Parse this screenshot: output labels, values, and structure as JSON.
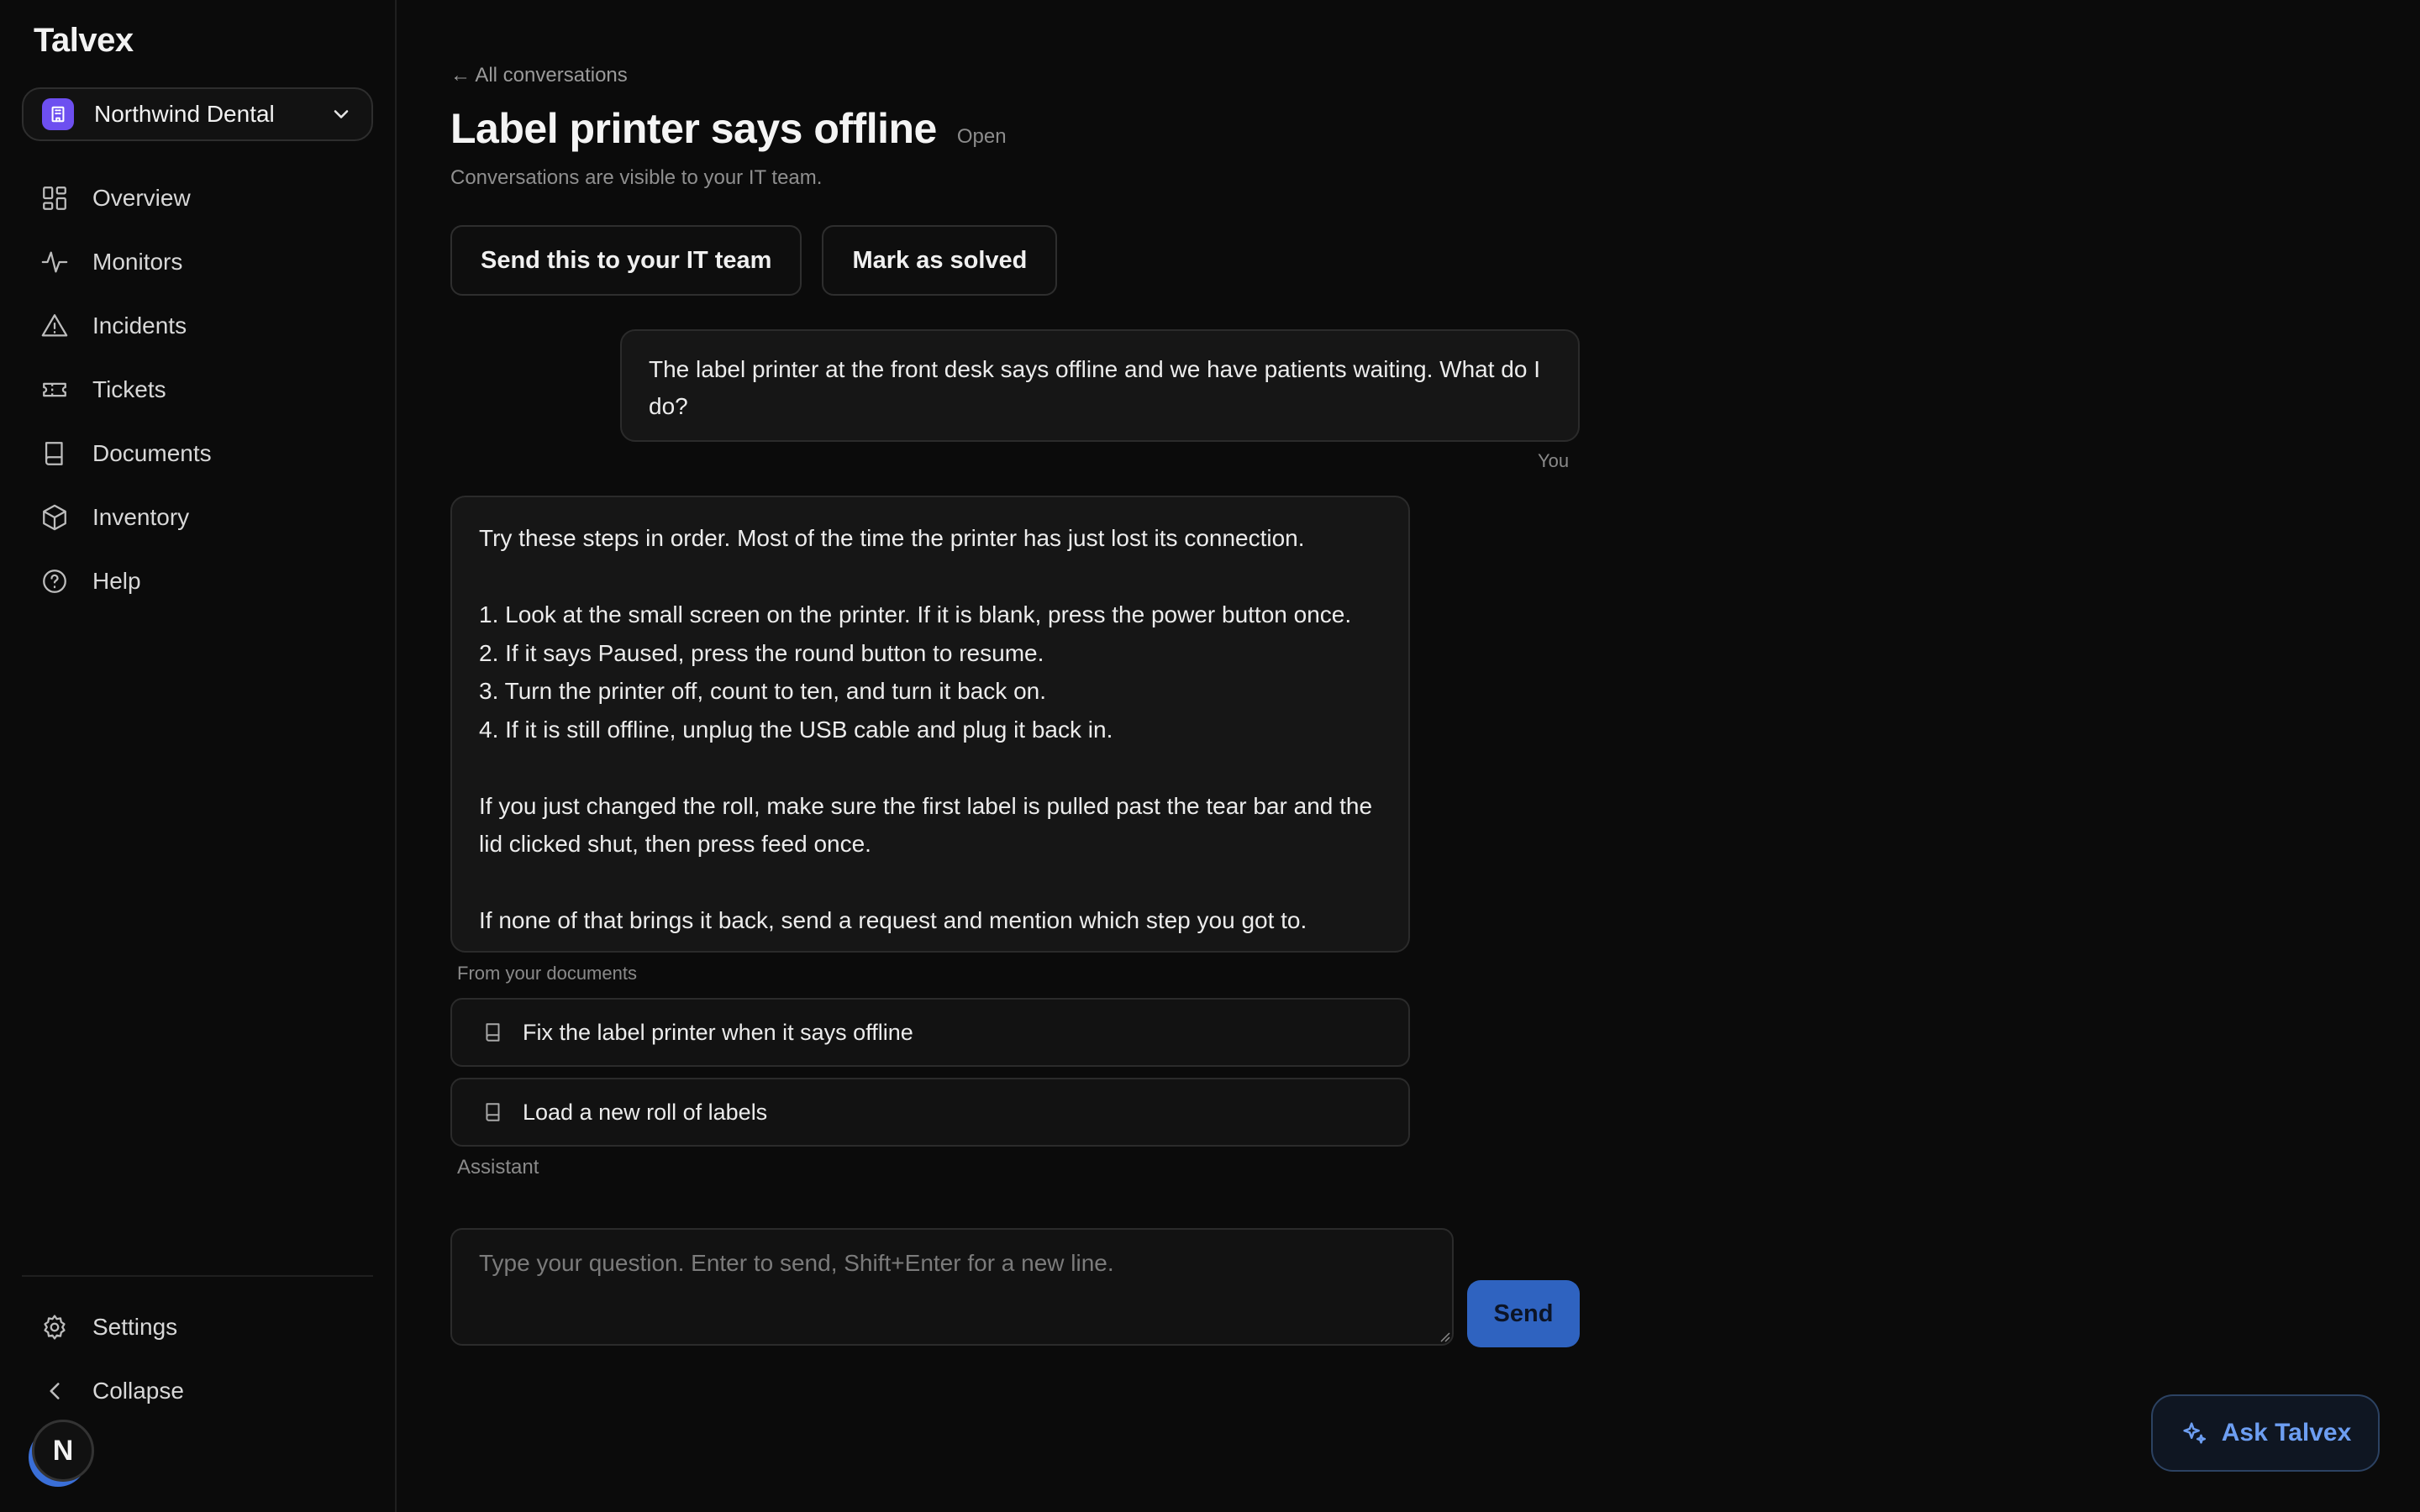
{
  "app": {
    "name": "Talvex"
  },
  "org": {
    "name": "Northwind Dental"
  },
  "sidebar": {
    "items": [
      {
        "label": "Overview",
        "icon": "grid-icon"
      },
      {
        "label": "Monitors",
        "icon": "pulse-icon"
      },
      {
        "label": "Incidents",
        "icon": "warning-icon"
      },
      {
        "label": "Tickets",
        "icon": "ticket-icon"
      },
      {
        "label": "Documents",
        "icon": "book-icon"
      },
      {
        "label": "Inventory",
        "icon": "box-icon"
      },
      {
        "label": "Help",
        "icon": "help-icon"
      }
    ],
    "bottom": [
      {
        "label": "Settings",
        "icon": "gear-icon"
      },
      {
        "label": "Collapse",
        "icon": "chevron-left-icon"
      }
    ],
    "avatar_initial": "N"
  },
  "header": {
    "back_link": "← All conversations",
    "title": "Label printer says offline",
    "status": "Open",
    "subtitle": "Conversations are visible to your IT team."
  },
  "actions": {
    "send_it": "Send this to your IT team",
    "mark_solved": "Mark as solved"
  },
  "conversation": {
    "user_message": "The label printer at the front desk says offline and we have patients waiting. What do I do?",
    "user_label": "You",
    "assistant_message": "Try these steps in order. Most of the time the printer has just lost its connection.\n\n1. Look at the small screen on the printer. If it is blank, press the power button once.\n2. If it says Paused, press the round button to resume.\n3. Turn the printer off, count to ten, and turn it back on.\n4. If it is still offline, unplug the USB cable and plug it back in.\n\nIf you just changed the roll, make sure the first label is pulled past the tear bar and the lid clicked shut, then press feed once.\n\nIf none of that brings it back, send a request and mention which step you got to.",
    "sources_label": "From your documents",
    "sources": [
      {
        "title": "Fix the label printer when it says offline"
      },
      {
        "title": "Load a new roll of labels"
      }
    ],
    "assistant_label": "Assistant"
  },
  "composer": {
    "placeholder": "Type your question. Enter to send, Shift+Enter for a new line.",
    "value": "",
    "send_label": "Send"
  },
  "fab": {
    "label": "Ask Talvex",
    "icon": "sparkle-icon"
  },
  "colors": {
    "background": "#0b0b0b",
    "accent": "#2f63c0",
    "org_icon": "#6d4ff0",
    "fab_text": "#6d9ef2"
  }
}
